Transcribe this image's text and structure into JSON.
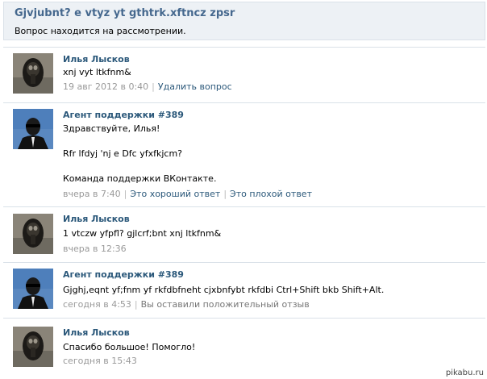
{
  "question": {
    "title": "Gjvjubnt? e vtyz yt gthtrk.xftncz zpsr",
    "status": "Вопрос находится на рассмотрении."
  },
  "messages": [
    {
      "author": "Илья Лысков",
      "avatar": "user-avatar-icon",
      "lines": [
        "xnj vyt ltkfnm&"
      ],
      "time": "19 авг 2012 в 0:40",
      "actions": [
        "Удалить вопрос"
      ]
    },
    {
      "author": "Агент поддержки #389",
      "avatar": "agent-avatar-icon",
      "lines": [
        "Здравствуйте, Илья!",
        "Rfr lfdyj 'nj e Dfc yfxfkjcm?",
        "Команда поддержки ВКонтакте."
      ],
      "time": "вчера в 7:40",
      "actions": [
        "Это хороший ответ",
        "Это плохой ответ"
      ]
    },
    {
      "author": "Илья Лысков",
      "avatar": "user-avatar-icon",
      "lines": [
        "1 vtczw yfpfl? gjlcrf;bnt xnj ltkfnm&"
      ],
      "time": "вчера в 12:36",
      "actions": []
    },
    {
      "author": "Агент поддержки #389",
      "avatar": "agent-avatar-icon",
      "lines": [
        "Gjghj,eqnt yf;fnm yf rkfdbfneht cjxbnfybt rkfdbi Ctrl+Shift bkb Shift+Alt."
      ],
      "time": "сегодня в 4:53",
      "feedback": "Вы оставили положительный отзыв",
      "actions": []
    },
    {
      "author": "Илья Лысков",
      "avatar": "user-avatar-icon",
      "lines": [
        "Спасибо большое! Помогло!"
      ],
      "time": "сегодня в 15:43",
      "actions": []
    }
  ],
  "watermark": "pikabu.ru"
}
